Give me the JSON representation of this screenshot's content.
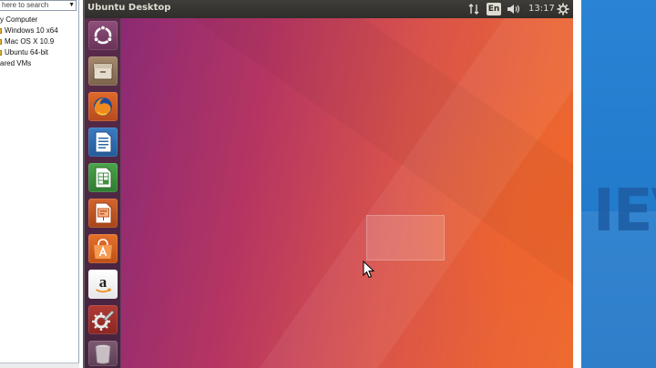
{
  "host": {
    "search_placeholder": "here to search",
    "library": [
      "y Computer",
      "Windows 10 x64",
      "Mac OS X 10.9",
      "Ubuntu 64-bit",
      "ared VMs"
    ],
    "watermark": "IEV",
    "accent_color": "#1d74c6"
  },
  "vm": {
    "title": "Ubuntu Desktop",
    "indicators": {
      "network_icon": "network-updown-icon",
      "language": "En",
      "volume_icon": "speaker-icon",
      "clock": "13:17",
      "session_icon": "gear-icon"
    },
    "launcher": [
      {
        "name": "ubuntu-dash-icon"
      },
      {
        "name": "files-icon"
      },
      {
        "name": "firefox-icon"
      },
      {
        "name": "libreoffice-writer-icon"
      },
      {
        "name": "libreoffice-calc-icon"
      },
      {
        "name": "libreoffice-impress-icon"
      },
      {
        "name": "software-center-icon"
      },
      {
        "name": "amazon-icon"
      },
      {
        "name": "system-settings-icon"
      },
      {
        "name": "trash-icon"
      }
    ],
    "launcher_amazon_letter": "a",
    "wallpaper_colors": [
      "#8c2a74",
      "#d9534a",
      "#ee6b30"
    ]
  }
}
